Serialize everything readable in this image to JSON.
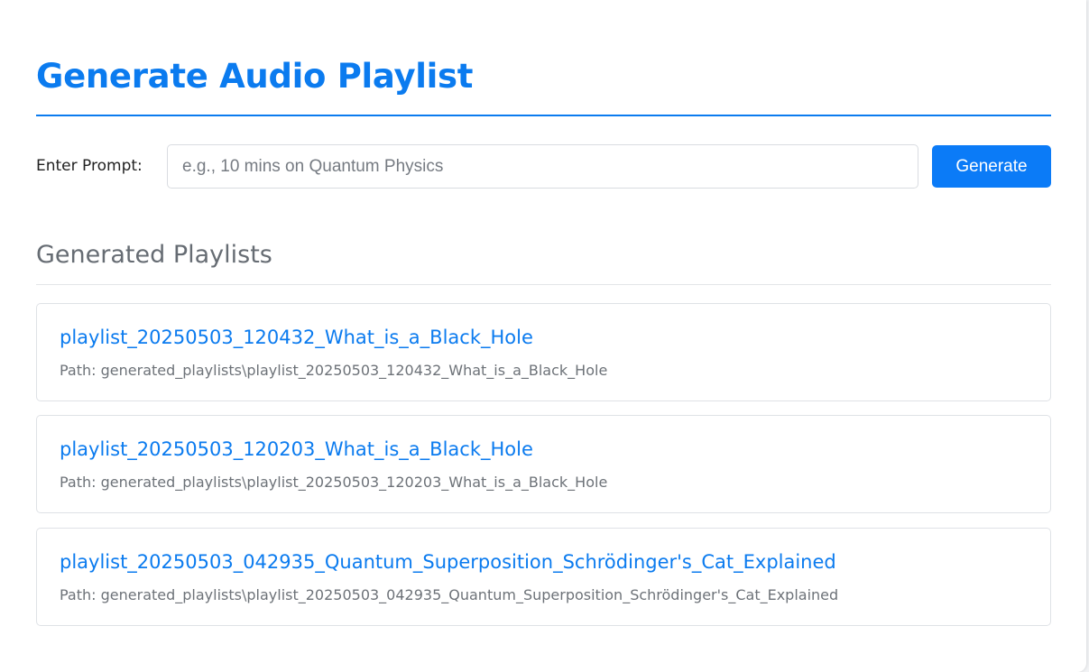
{
  "header": {
    "title": "Generate Audio Playlist"
  },
  "prompt": {
    "label": "Enter Prompt:",
    "value": "",
    "placeholder": "e.g., 10 mins on Quantum Physics",
    "button_label": "Generate"
  },
  "playlists_section": {
    "title": "Generated Playlists",
    "items": [
      {
        "name": "playlist_20250503_120432_What_is_a_Black_Hole",
        "path": "Path: generated_playlists\\playlist_20250503_120432_What_is_a_Black_Hole"
      },
      {
        "name": "playlist_20250503_120203_What_is_a_Black_Hole",
        "path": "Path: generated_playlists\\playlist_20250503_120203_What_is_a_Black_Hole"
      },
      {
        "name": "playlist_20250503_042935_Quantum_Superposition_Schrödinger's_Cat_Explained",
        "path": "Path: generated_playlists\\playlist_20250503_042935_Quantum_Superposition_Schrödinger's_Cat_Explained"
      }
    ]
  },
  "colors": {
    "accent": "#0b7bef",
    "button": "#0b7bf7",
    "muted_text": "#6d7278",
    "border": "#dfe2e6"
  }
}
